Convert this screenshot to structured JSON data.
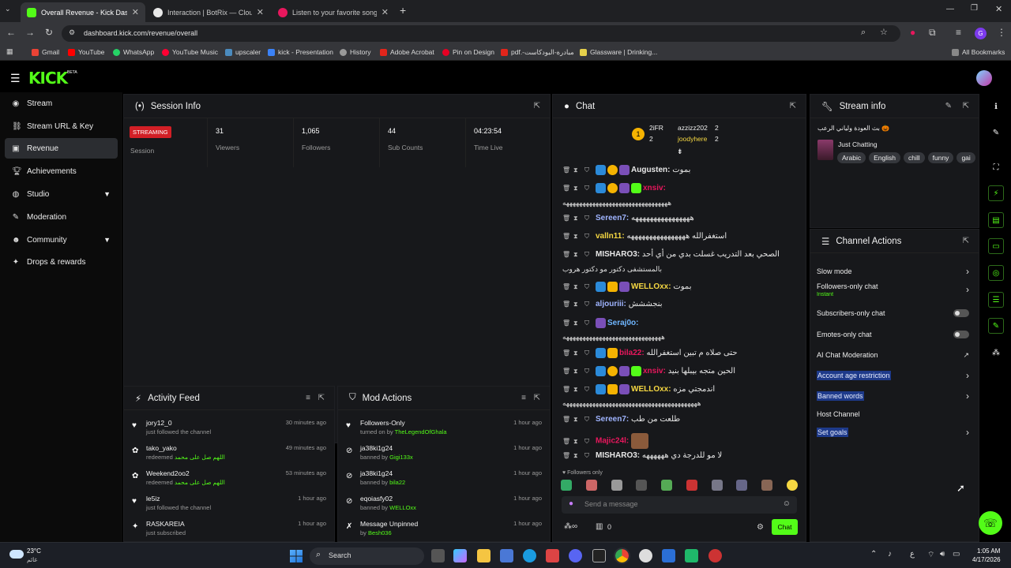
{
  "browser": {
    "tabs": [
      {
        "title": "Overall Revenue - Kick Dashboard",
        "active": true,
        "color": "#53fc18"
      },
      {
        "title": "Interaction | BotRix — Cloud St",
        "active": false,
        "color": "#e8e8e8"
      },
      {
        "title": "Listen to your favorite songs an",
        "active": false,
        "color": "#e8175d"
      }
    ],
    "url": "dashboard.kick.com/revenue/overall",
    "profile_initial": "G",
    "bookmarks": [
      "Gmail",
      "YouTube",
      "WhatsApp",
      "YouTube Music",
      "upscaler",
      "kick - Presentation",
      "History",
      "Adobe Acrobat",
      "Pin on Design",
      "pdf.-مبادرة-البودكاست",
      "Glassware | Drinking..."
    ],
    "all_bookmarks": "All Bookmarks"
  },
  "app": {
    "logo": "KICK",
    "logo_badge": "BETA",
    "nav": [
      {
        "label": "Stream",
        "icon": "broadcast-icon"
      },
      {
        "label": "Stream URL & Key",
        "icon": "link-icon"
      },
      {
        "label": "Revenue",
        "icon": "money-icon",
        "selected": true
      },
      {
        "label": "Achievements",
        "icon": "trophy-icon"
      },
      {
        "label": "Studio",
        "icon": "globe-icon",
        "chevron": true
      },
      {
        "label": "Moderation",
        "icon": "wrench-icon"
      },
      {
        "label": "Community",
        "icon": "people-icon",
        "chevron": true
      },
      {
        "label": "Drops & rewards",
        "icon": "gift-icon"
      }
    ]
  },
  "session": {
    "title": "Session Info",
    "badge": "STREAMING",
    "stats": [
      {
        "value": "",
        "label": "Session"
      },
      {
        "value": "31",
        "label": "Viewers"
      },
      {
        "value": "1,065",
        "label": "Followers"
      },
      {
        "value": "44",
        "label": "Sub Counts"
      },
      {
        "value": "04:23:54",
        "label": "Time Live"
      }
    ]
  },
  "activity": {
    "title": "Activity Feed",
    "items": [
      {
        "name": "jory12_0",
        "sub": "just followed the channel",
        "time": "30 minutes ago",
        "icon": "heart-icon"
      },
      {
        "name": "tako_yako",
        "sub": "redeemed",
        "extra": "اللهم صل على محمد",
        "time": "49 minutes ago",
        "icon": "reward-icon"
      },
      {
        "name": "Weekend2oo2",
        "sub": "redeemed",
        "extra": "اللهم صل على محمد",
        "time": "53 minutes ago",
        "icon": "reward-icon"
      },
      {
        "name": "le5iz",
        "sub": "just followed the channel",
        "time": "1 hour ago",
        "icon": "heart-icon"
      },
      {
        "name": "RASKAREIA",
        "sub": "just subscribed",
        "time": "1 hour ago",
        "icon": "star-icon"
      }
    ]
  },
  "mod": {
    "title": "Mod Actions",
    "items": [
      {
        "name": "Followers-Only",
        "pre": "turned on by",
        "by": "TheLegendOfGhala",
        "time": "1 hour ago",
        "icon": "heart-icon"
      },
      {
        "name": "ja38ki1g24",
        "pre": "banned by",
        "by": "Gigi133x",
        "time": "1 hour ago",
        "icon": "ban-icon"
      },
      {
        "name": "ja38ki1g24",
        "pre": "banned by",
        "by": "bila22",
        "time": "1 hour ago",
        "icon": "ban-icon"
      },
      {
        "name": "eqoiasfy02",
        "pre": "banned by",
        "by": "WELLOxx",
        "time": "1 hour ago",
        "icon": "ban-icon"
      },
      {
        "name": "Message Unpinned",
        "pre": "by",
        "by": "Besh036",
        "time": "1 hour ago",
        "icon": "unpin-icon"
      }
    ]
  },
  "chat": {
    "title": "Chat",
    "top": [
      {
        "name": "2iFR",
        "count": "2"
      },
      {
        "name": "azzizz202",
        "count": "2"
      },
      {
        "name": "joodyhere",
        "count": "2"
      }
    ],
    "messages": [
      {
        "user": "Augusten:",
        "color": "#e8e8e8",
        "text": "بموت"
      },
      {
        "user": "xnsiv:",
        "color": "#e8175d",
        "text": ""
      },
      {
        "cont": "ههههههههههههههههههههههههههههههههه"
      },
      {
        "user": "Sereen7:",
        "color": "#9fb4ff",
        "text": "ههههههههههههههههه"
      },
      {
        "user": "valln11:",
        "color": "#f5d742",
        "text": "استغفرالله ههههههههههههههههه"
      },
      {
        "user": "MISHARO3:",
        "color": "#e8e8e8",
        "text": "الصحي بعد التدريب غسلت بدي من أي أحد"
      },
      {
        "cont": "بالمستشفى دكتور مو دكتور هروب"
      },
      {
        "user": "WELLOxx:",
        "color": "#f5d742",
        "text": "بموت"
      },
      {
        "user": "aljouriii:",
        "color": "#9fb4ff",
        "text": "بنجششش"
      },
      {
        "user": "Seraj0o:",
        "color": "#6fb6ff",
        "text": ""
      },
      {
        "cont": "ههههههههههههههههههههههههههههههه"
      },
      {
        "user": "bila22:",
        "color": "#e8175d",
        "text": "حتى صلاه م تبين استغفرالله"
      },
      {
        "user": "xnsiv:",
        "color": "#e8175d",
        "text": "الحين متجه بيبلها بنيد"
      },
      {
        "user": "WELLOxx:",
        "color": "#f5d742",
        "text": "اندمجتي مزه"
      },
      {
        "cont": "هههههههههههههههههههههههههههههههههههههههههه"
      },
      {
        "user": "Sereen7:",
        "color": "#9fb4ff",
        "text": "طلعت من طب"
      },
      {
        "user": "Majic24l:",
        "color": "#e8175d",
        "text": ""
      },
      {
        "user": "MISHARO3:",
        "color": "#e8e8e8",
        "text": "لا مو للدرجة دي ههههههه"
      }
    ],
    "followers_only": "Followers only",
    "placeholder": "Send a message",
    "count": "0",
    "send": "Chat"
  },
  "stream_info": {
    "title": "Stream info",
    "stream_title": "بث العودة ولياني الرعب 🎃",
    "category": "Just Chatting",
    "tags": [
      "Arabic",
      "English",
      "chill",
      "funny",
      "gai"
    ]
  },
  "channel": {
    "title": "Channel Actions",
    "items": [
      {
        "label": "Slow mode",
        "type": "arrow"
      },
      {
        "label": "Followers-only chat",
        "sub": "Instant",
        "type": "arrow"
      },
      {
        "label": "Subscribers-only chat",
        "type": "toggle"
      },
      {
        "label": "Emotes-only chat",
        "type": "toggle"
      },
      {
        "label": "AI Chat Moderation",
        "type": "external"
      },
      {
        "label": "Account age restriction",
        "type": "arrow",
        "highlight": true
      },
      {
        "label": "Banned words",
        "type": "arrow",
        "highlight": true
      },
      {
        "label": "Host Channel",
        "type": "none"
      },
      {
        "label": "Set goals",
        "type": "arrow",
        "highlight": true
      }
    ]
  },
  "taskbar": {
    "temp": "23°C",
    "weather": "غائم",
    "search": "Search",
    "lang": "ع",
    "time": "1:05 AM",
    "date": "4/17/2026"
  },
  "colors": {
    "accent": "#53fc18",
    "panel": "#17181b",
    "bg": "#000000"
  }
}
